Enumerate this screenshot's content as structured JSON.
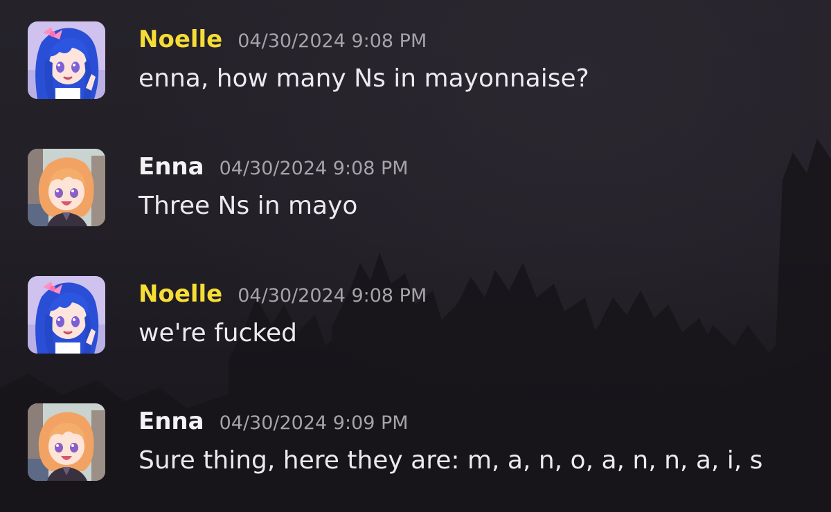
{
  "messages": [
    {
      "author": "Noelle",
      "timestamp": "04/30/2024 9:08 PM",
      "text": "enna, how many Ns in mayonnaise?"
    },
    {
      "author": "Enna",
      "timestamp": "04/30/2024 9:08 PM",
      "text": "Three Ns in mayo"
    },
    {
      "author": "Noelle",
      "timestamp": "04/30/2024 9:08 PM",
      "text": "we're fucked"
    },
    {
      "author": "Enna",
      "timestamp": "04/30/2024 9:09 PM",
      "text": "Sure thing, here they are: m, a, n, o, a, n, n, a, i, s"
    }
  ],
  "colors": {
    "noelle_name": "#f6dd36",
    "enna_name": "#f4f2f5",
    "timestamp": "#a6a3aa",
    "message_text": "#eceaee",
    "background": "#1f1c23"
  },
  "icons": {
    "noelle_avatar": "blue-haired-anime-girl-avatar-icon",
    "enna_avatar": "orange-haired-anime-girl-avatar-icon"
  }
}
